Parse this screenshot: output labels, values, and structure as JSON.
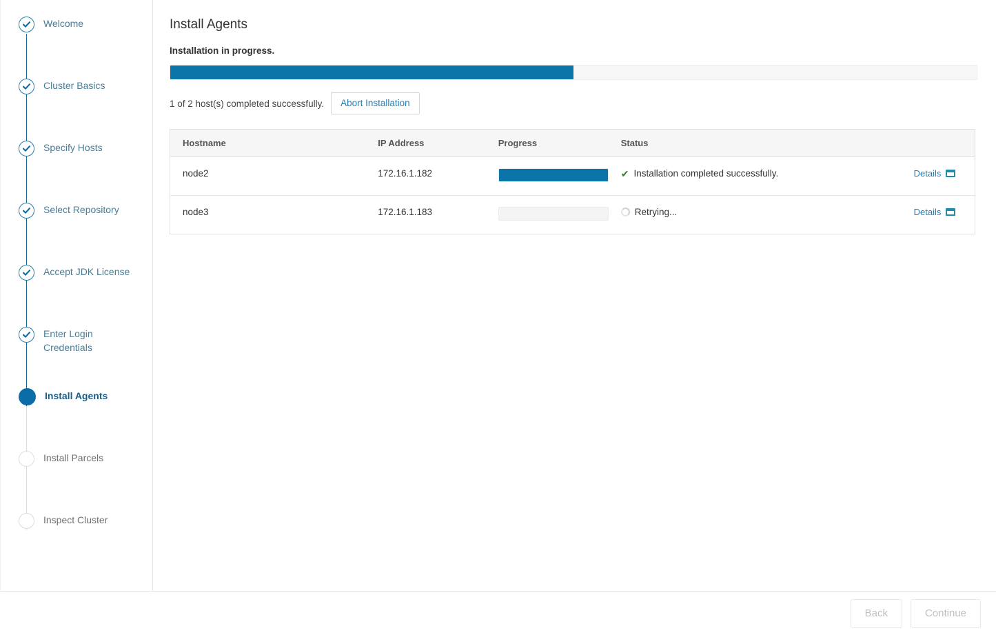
{
  "colors": {
    "accent": "#0b74a8",
    "link": "#1f7fb5",
    "step_done": "#2b7da6",
    "step_current": "#0b6ca8",
    "step_pending": "#dddddd",
    "success": "#3b7b2f"
  },
  "sidebar": {
    "steps": [
      {
        "label": "Welcome",
        "state": "done"
      },
      {
        "label": "Cluster Basics",
        "state": "done"
      },
      {
        "label": "Specify Hosts",
        "state": "done"
      },
      {
        "label": "Select Repository",
        "state": "done"
      },
      {
        "label": "Accept JDK License",
        "state": "done"
      },
      {
        "label": "Enter Login Credentials",
        "state": "done"
      },
      {
        "label": "Install Agents",
        "state": "current"
      },
      {
        "label": "Install Parcels",
        "state": "pending"
      },
      {
        "label": "Inspect Cluster",
        "state": "pending"
      }
    ]
  },
  "main": {
    "title": "Install Agents",
    "status_heading": "Installation in progress.",
    "overall_progress_percent": 50,
    "hosts_completed_text": "1 of 2 host(s) completed successfully.",
    "abort_button_label": "Abort Installation",
    "table": {
      "columns": [
        "Hostname",
        "IP Address",
        "Progress",
        "Status",
        ""
      ],
      "rows": [
        {
          "hostname": "node2",
          "ip": "172.16.1.182",
          "progress_percent": 100,
          "status_icon": "check-icon",
          "status": "Installation completed successfully.",
          "details_label": "Details"
        },
        {
          "hostname": "node3",
          "ip": "172.16.1.183",
          "progress_percent": 0,
          "status_icon": "spinner-icon",
          "status": "Retrying...",
          "details_label": "Details"
        }
      ]
    }
  },
  "footer": {
    "back_label": "Back",
    "continue_label": "Continue"
  }
}
